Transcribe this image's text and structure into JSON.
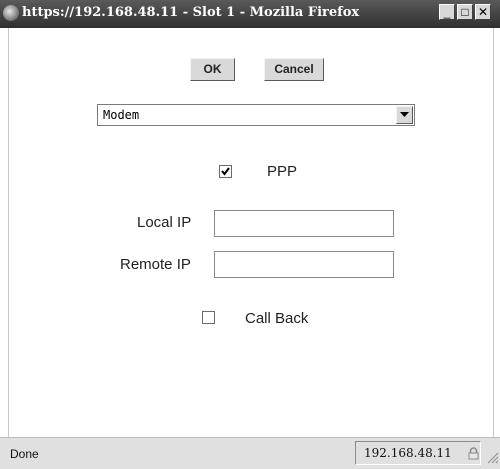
{
  "window": {
    "title": "https://192.168.48.11 - Slot 1 - Mozilla Firefox",
    "minimize_glyph": "_",
    "maximize_glyph": "□",
    "close_glyph": "✕"
  },
  "toolbar": {
    "ok_label": "OK",
    "cancel_label": "Cancel"
  },
  "mode_select": {
    "selected": "Modem"
  },
  "ppp": {
    "label": "PPP",
    "checked": true
  },
  "fields": {
    "local_ip_label": "Local IP",
    "local_ip_value": "",
    "remote_ip_label": "Remote IP",
    "remote_ip_value": ""
  },
  "callback": {
    "label": "Call Back",
    "checked": false
  },
  "status": {
    "text": "Done",
    "host": "192.168.48.11"
  }
}
